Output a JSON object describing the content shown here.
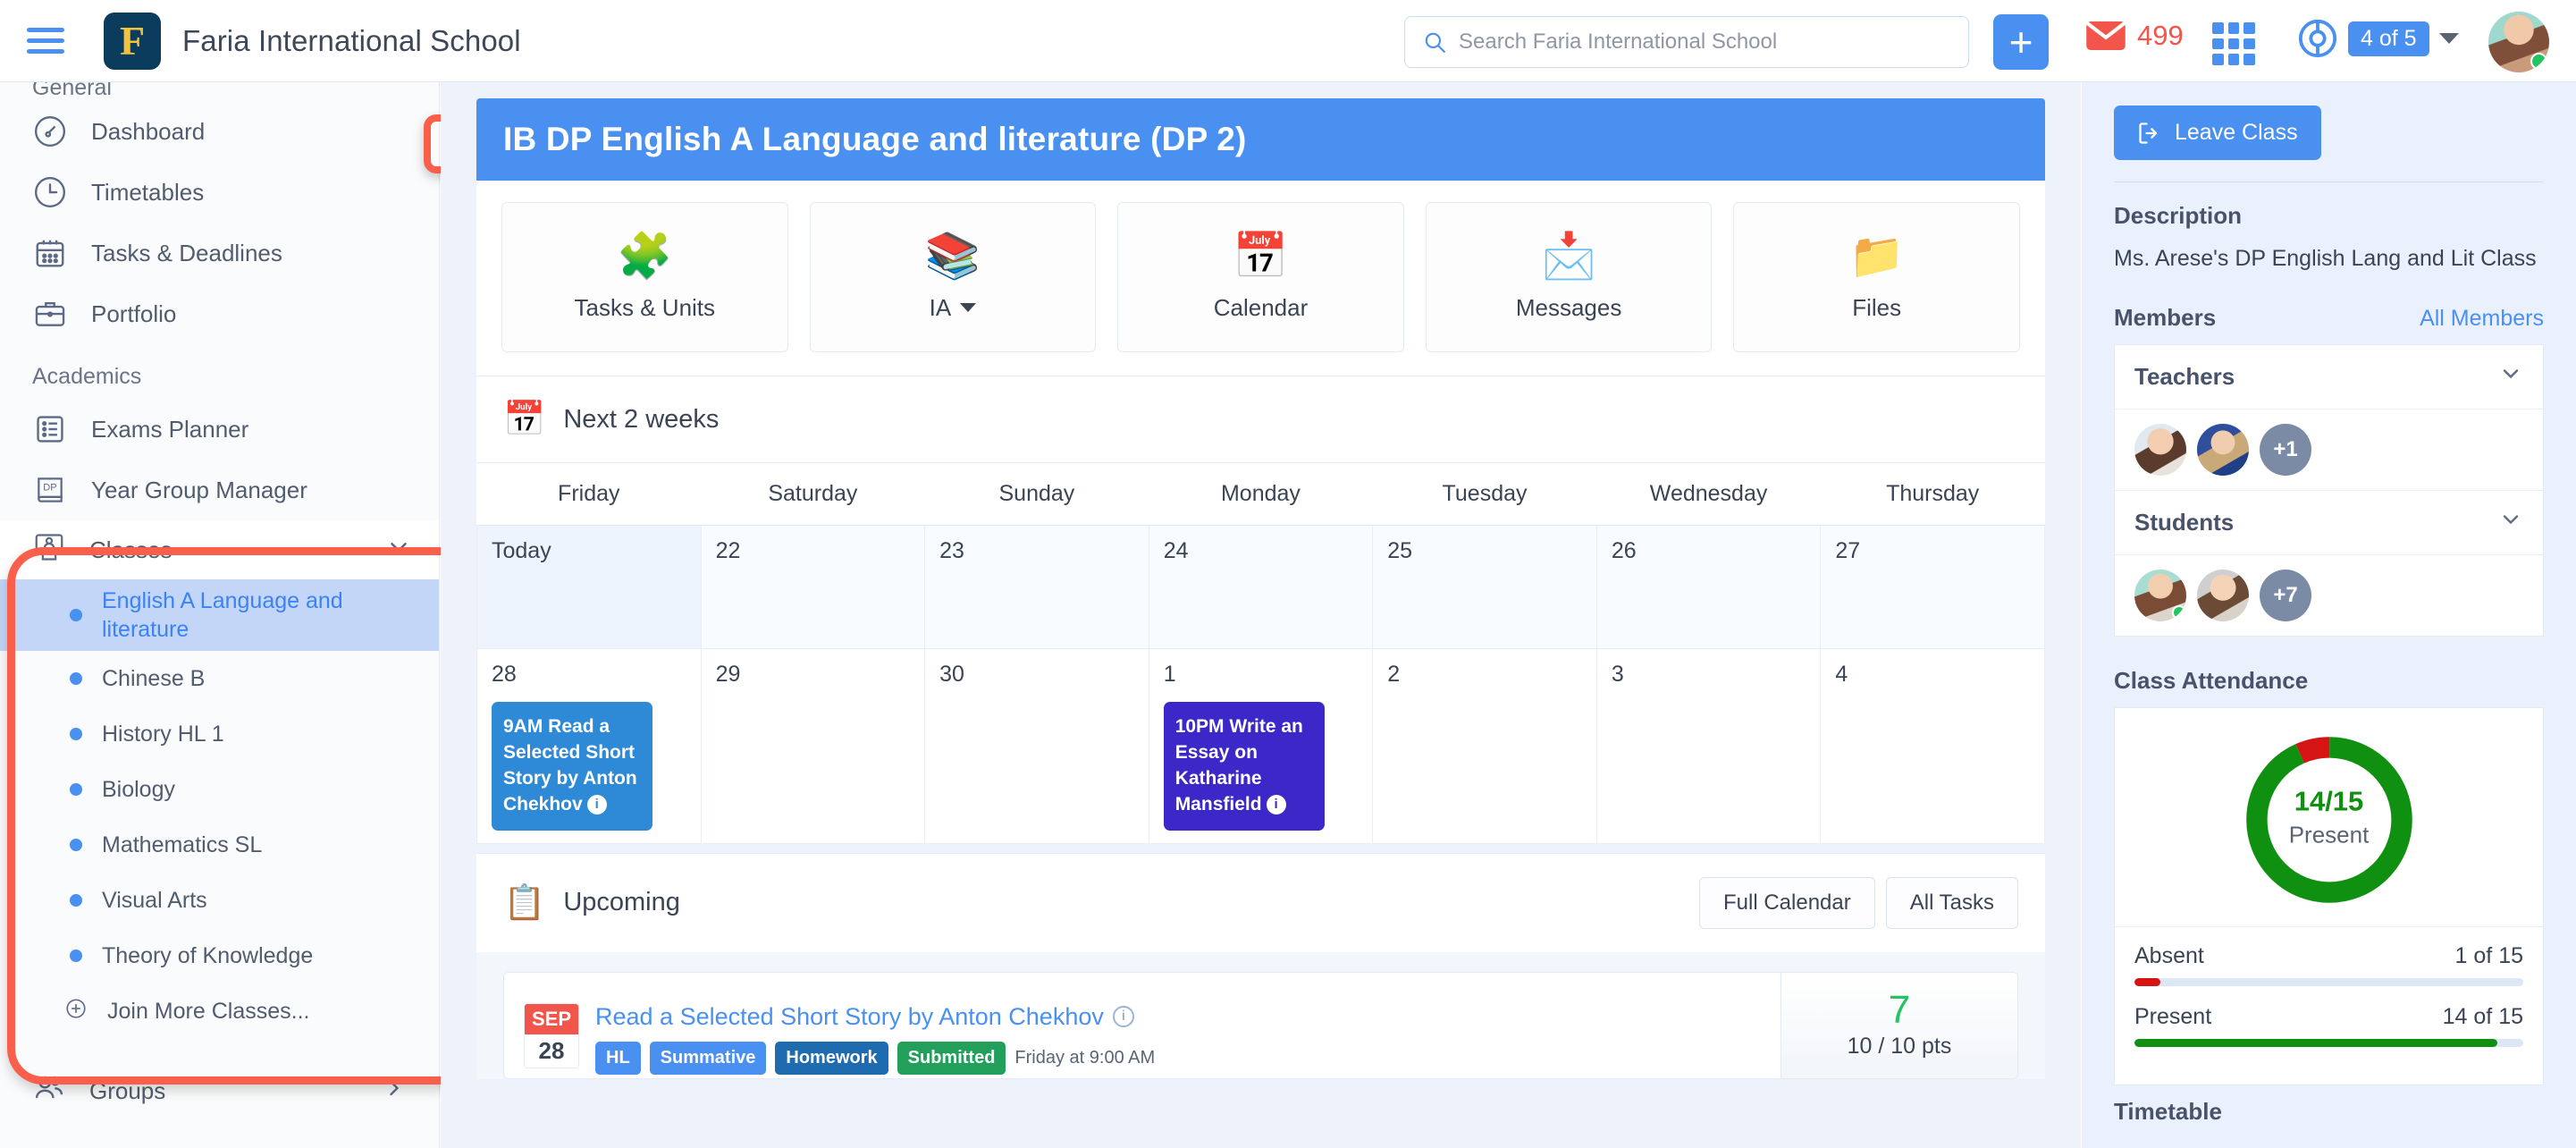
{
  "header": {
    "menu_icon": "hamburger-icon",
    "logo_letter": "F",
    "school_name": "Faria International School",
    "search_placeholder": "Search Faria International School",
    "search_value": "",
    "add_label": "+",
    "mail_count": "499",
    "apps_icon": "grid-apps-icon",
    "help_badge": "4 of 5",
    "accent_blue": "#4a90f0",
    "alert_red": "#f2554a"
  },
  "sidebar": {
    "sections": [
      {
        "title": "General",
        "items": [
          {
            "label": "Dashboard",
            "icon": "speedometer-icon"
          },
          {
            "label": "Timetables",
            "icon": "clock-icon"
          },
          {
            "label": "Tasks & Deadlines",
            "icon": "calendar-icon"
          },
          {
            "label": "Portfolio",
            "icon": "briefcase-icon"
          }
        ]
      },
      {
        "title": "Academics",
        "items": [
          {
            "label": "Exams Planner",
            "icon": "list-icon"
          },
          {
            "label": "Year Group Manager",
            "icon": "dp-book-icon"
          }
        ]
      }
    ],
    "classes": {
      "label": "Classes",
      "icon": "teacher-board-icon",
      "chevron": "chevron-down-icon",
      "items": [
        {
          "label": "English A Language and literature",
          "active": true
        },
        {
          "label": "Chinese B",
          "active": false
        },
        {
          "label": "History HL 1",
          "active": false
        },
        {
          "label": "Biology",
          "active": false
        },
        {
          "label": "Mathematics SL",
          "active": false
        },
        {
          "label": "Visual Arts",
          "active": false
        },
        {
          "label": "Theory of Knowledge",
          "active": false
        }
      ],
      "join_label": "Join More Classes...",
      "join_icon": "plus-circle-icon"
    },
    "groups": {
      "label": "Groups",
      "icon": "people-icon",
      "chevron": "chevron-right-icon"
    },
    "highlight_color": "#f95f4b"
  },
  "main": {
    "class_title": "IB DP English A Language and literature (DP 2)",
    "tabs": [
      {
        "label": "Tasks & Units",
        "icon": "puzzle-icon",
        "glyph": "🧩"
      },
      {
        "label": "IA",
        "icon": "books-icon",
        "glyph": "📚",
        "has_caret": true
      },
      {
        "label": "Calendar",
        "icon": "calendar-21-icon",
        "glyph": "📅"
      },
      {
        "label": "Messages",
        "icon": "envelope-icon",
        "glyph": "📩"
      },
      {
        "label": "Files",
        "icon": "folder-icon",
        "glyph": "📁"
      }
    ],
    "calendar": {
      "title": "Next 2 weeks",
      "icon": "calendar-icon",
      "day_headers": [
        "Friday",
        "Saturday",
        "Sunday",
        "Monday",
        "Tuesday",
        "Wednesday",
        "Thursday"
      ],
      "week1": [
        {
          "day": "Today",
          "is_today": true,
          "events": []
        },
        {
          "day": "22",
          "events": []
        },
        {
          "day": "23",
          "events": []
        },
        {
          "day": "24",
          "events": []
        },
        {
          "day": "25",
          "events": []
        },
        {
          "day": "26",
          "events": []
        },
        {
          "day": "27",
          "events": []
        }
      ],
      "week2": [
        {
          "day": "28",
          "events": [
            {
              "text": "9AM Read a Selected Short Story by Anton Chekhov",
              "color": "blue"
            }
          ]
        },
        {
          "day": "29",
          "events": []
        },
        {
          "day": "30",
          "events": []
        },
        {
          "day": "1",
          "events": [
            {
              "text": "10PM Write an Essay on Katharine Mansfield",
              "color": "indigo"
            }
          ]
        },
        {
          "day": "2",
          "events": []
        },
        {
          "day": "3",
          "events": []
        },
        {
          "day": "4",
          "events": []
        }
      ]
    },
    "upcoming": {
      "title": "Upcoming",
      "icon": "checklist-icon",
      "full_calendar_label": "Full Calendar",
      "all_tasks_label": "All Tasks",
      "tasks": [
        {
          "month": "SEP",
          "day": "28",
          "title": "Read a Selected Short Story by Anton Chekhov",
          "badges": [
            {
              "label": "HL",
              "color": "#4a90f0"
            },
            {
              "label": "Summative",
              "color": "#4a90f0"
            },
            {
              "label": "Homework",
              "color": "#1f6bb0"
            },
            {
              "label": "Submitted",
              "color": "#22a05b"
            }
          ],
          "due": "Friday at 9:00 AM",
          "score": "7",
          "points": "10 / 10 pts"
        }
      ]
    }
  },
  "right": {
    "leave_label": "Leave Class",
    "leave_icon": "logout-icon",
    "description_title": "Description",
    "description_text": "Ms. Arese's DP English Lang and Lit Class",
    "members_title": "Members",
    "all_members_link": "All Members",
    "teachers": {
      "label": "Teachers",
      "overflow": "+1",
      "chevron": "chevron-down-icon"
    },
    "students": {
      "label": "Students",
      "overflow": "+7",
      "chevron": "chevron-down-icon"
    },
    "attendance_title": "Class Attendance",
    "timetable_title": "Timetable"
  },
  "chart_data": {
    "type": "pie",
    "title": "Class Attendance",
    "center_value": "14/15",
    "center_label": "Present",
    "categories": [
      "Present",
      "Absent"
    ],
    "values": [
      14,
      1
    ],
    "total": 15,
    "colors": [
      "#109010",
      "#d61414"
    ],
    "legend": [
      {
        "label": "Absent",
        "value": "1 of 15",
        "count": 1,
        "total": 15,
        "color": "#d61414"
      },
      {
        "label": "Present",
        "value": "14 of 15",
        "count": 14,
        "total": 15,
        "color": "#109010"
      }
    ]
  }
}
